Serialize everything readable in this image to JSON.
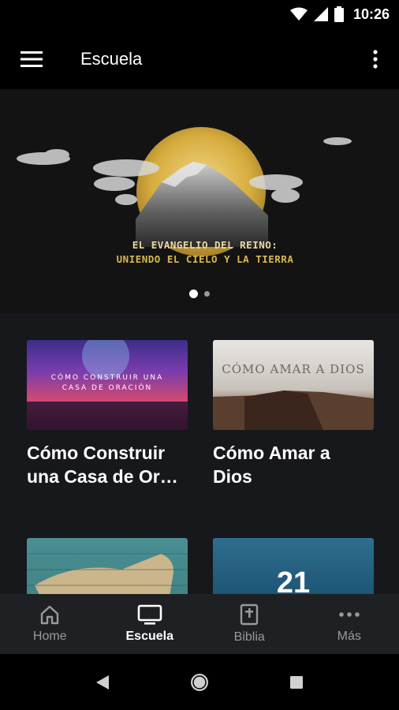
{
  "status": {
    "time": "10:26"
  },
  "appbar": {
    "title": "Escuela"
  },
  "hero": {
    "caption_line1": "EL EVANGELIO DEL REINO:",
    "caption_line2": "UNIENDO EL CIELO Y LA TIERRA",
    "slides": 2,
    "active_slide": 1
  },
  "cards": [
    {
      "title": "Cómo Construir una Casa de Or…",
      "thumb_text": "CÓMO CONSTRUIR UNA CASA DE ORACIÓN"
    },
    {
      "title": "Cómo Amar a Dios",
      "thumb_text": "CÓMO AMAR A DIOS"
    },
    {
      "title": "",
      "thumb_text": ""
    },
    {
      "title": "",
      "thumb_text": "21"
    }
  ],
  "bottom_nav": [
    {
      "label": "Home",
      "icon": "home-icon",
      "active": false
    },
    {
      "label": "Escuela",
      "icon": "tv-icon",
      "active": true
    },
    {
      "label": "Biblia",
      "icon": "bible-icon",
      "active": false
    },
    {
      "label": "Más",
      "icon": "more-horizontal-icon",
      "active": false
    }
  ],
  "colors": {
    "hero_gold": "#d9b84d",
    "background": "#17181b",
    "nav_bg": "#1f2023"
  }
}
